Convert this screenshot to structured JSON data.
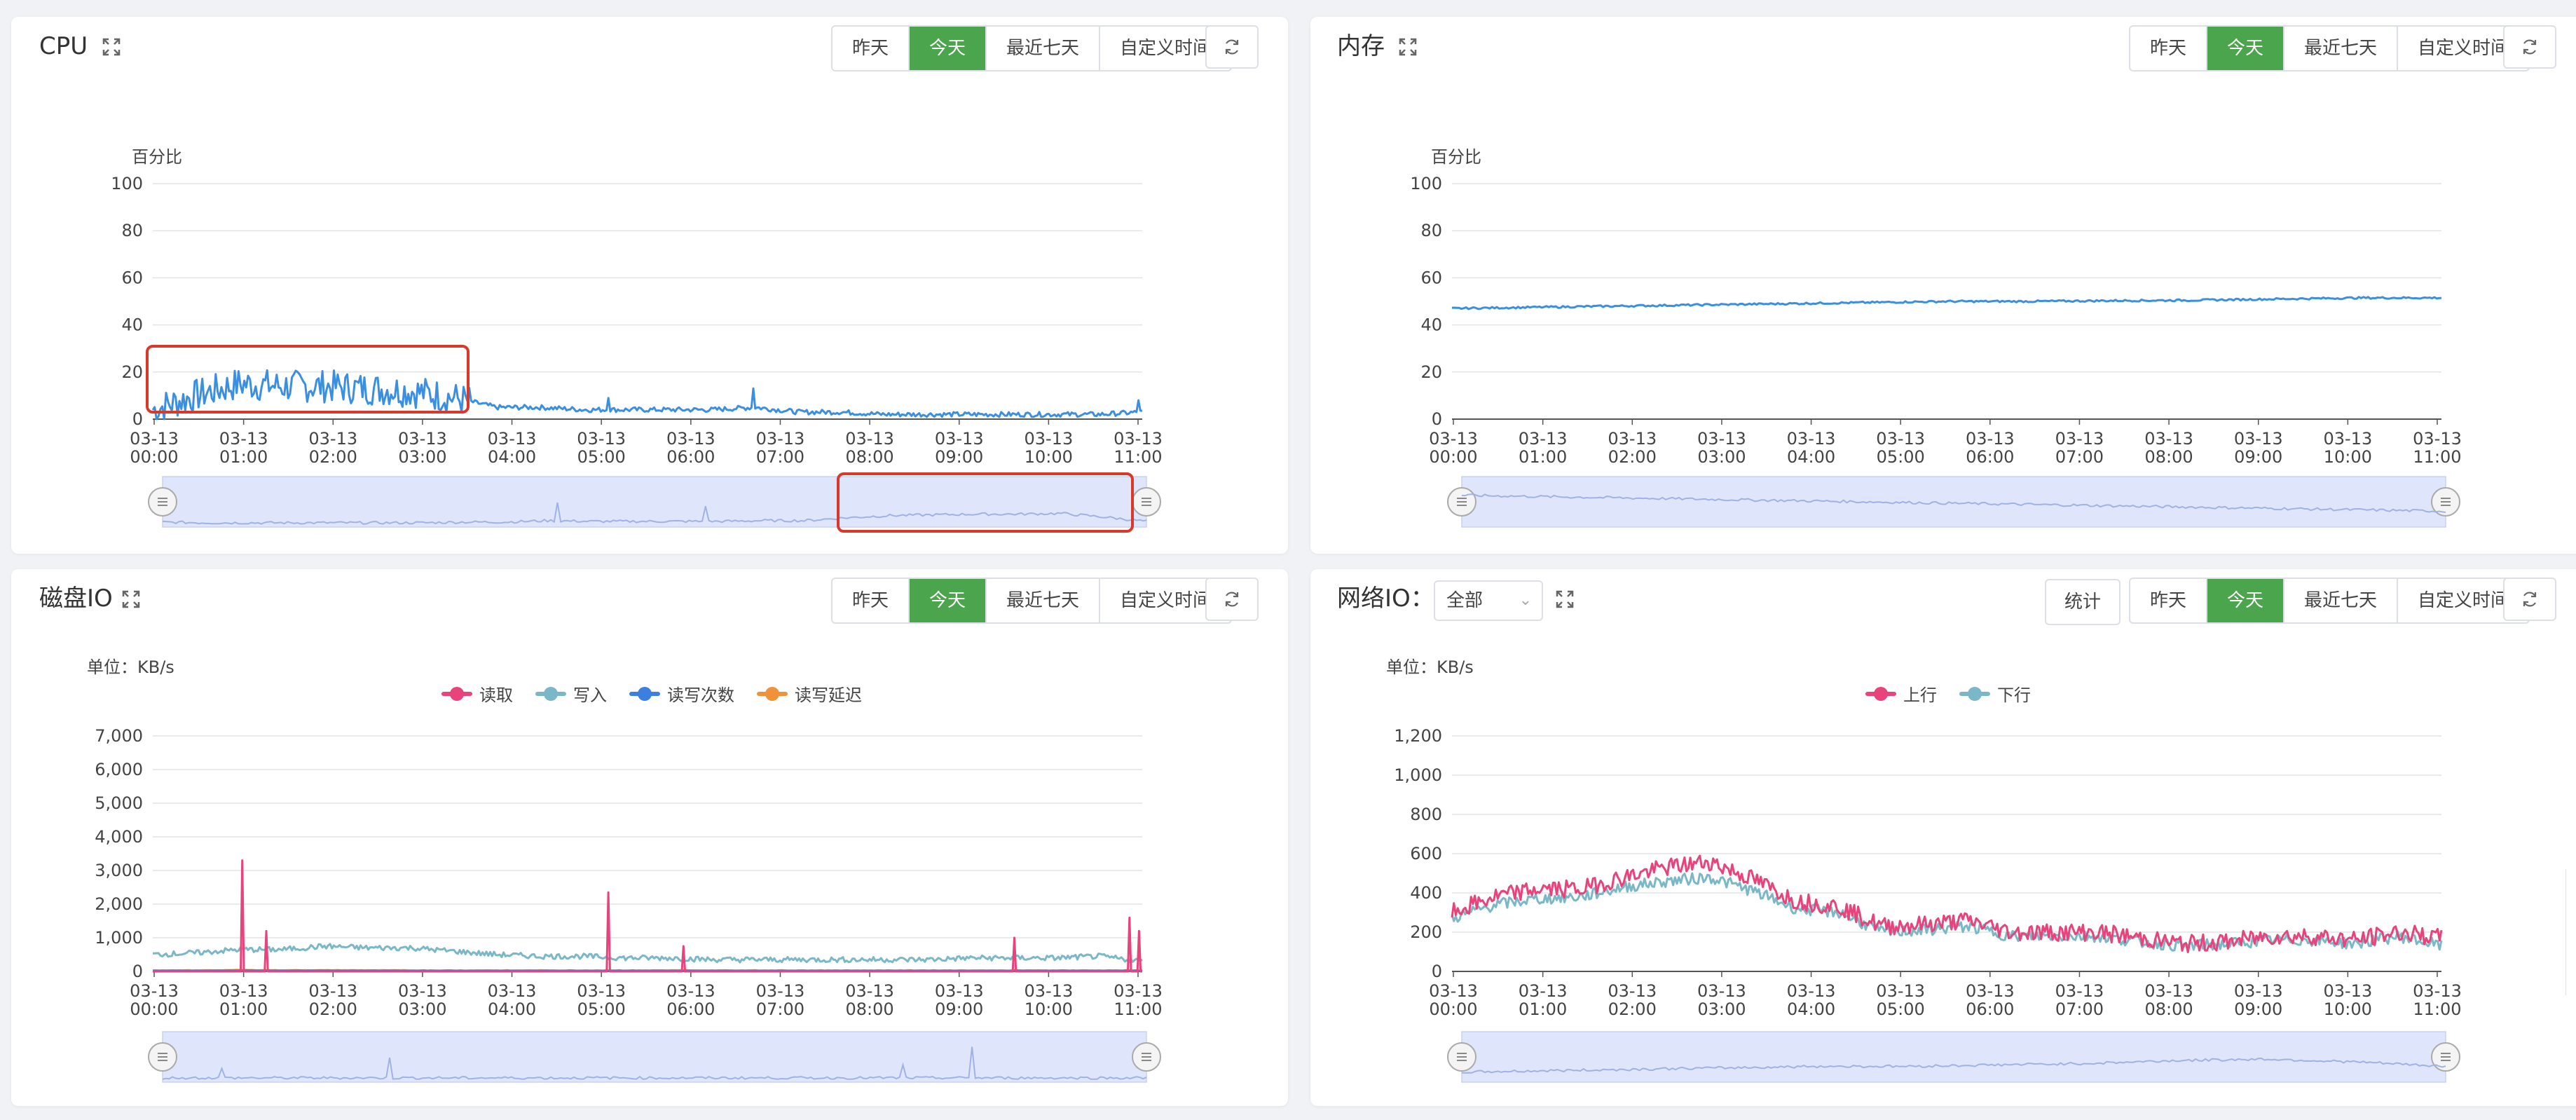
{
  "time_buttons": {
    "yesterday": "昨天",
    "today": "今天",
    "last7": "最近七天",
    "custom": "自定义时间"
  },
  "x_ticks": [
    [
      "03-13",
      "00:00"
    ],
    [
      "03-13",
      "01:00"
    ],
    [
      "03-13",
      "02:00"
    ],
    [
      "03-13",
      "03:00"
    ],
    [
      "03-13",
      "04:00"
    ],
    [
      "03-13",
      "05:00"
    ],
    [
      "03-13",
      "06:00"
    ],
    [
      "03-13",
      "07:00"
    ],
    [
      "03-13",
      "08:00"
    ],
    [
      "03-13",
      "09:00"
    ],
    [
      "03-13",
      "10:00"
    ],
    [
      "03-13",
      "11:00"
    ]
  ],
  "colors": {
    "accent": "#4aa54d",
    "cpu_line": "#3b8fe0",
    "mem_line": "#3b8fe0",
    "read": "#e8437a",
    "write": "#7ab8c8",
    "rw_count": "#3b7fe0",
    "rw_latency": "#f0923a",
    "up": "#e8437a",
    "down": "#7ab8c8",
    "highlight_box": "#d9392b",
    "dataZoom": "#dfe6fb"
  },
  "cpu": {
    "title": "CPU",
    "icons": {
      "expand": "expand-icon",
      "refresh": "refresh-icon"
    },
    "y_axis_name": "百分比",
    "y_ticks": [
      "100",
      "80",
      "60",
      "40",
      "20",
      "0"
    ]
  },
  "memory": {
    "title": "内存",
    "y_axis_name": "百分比",
    "y_ticks": [
      "100",
      "80",
      "60",
      "40",
      "20",
      "0"
    ]
  },
  "disk": {
    "title": "磁盘IO",
    "unit": "单位：KB/s",
    "legend": [
      "读取",
      "写入",
      "读写次数",
      "读写延迟"
    ],
    "y_ticks": [
      "7,000",
      "6,000",
      "5,000",
      "4,000",
      "3,000",
      "2,000",
      "1,000",
      "0"
    ]
  },
  "network": {
    "title": "网络IO：",
    "select_value": "全部",
    "stat_button": "统计",
    "unit": "单位：KB/s",
    "legend": [
      "上行",
      "下行"
    ],
    "y_ticks": [
      "1,200",
      "1,000",
      "800",
      "600",
      "400",
      "200",
      "0"
    ]
  },
  "chart_data": [
    {
      "type": "line",
      "title": "CPU",
      "ylabel": "百分比",
      "ylim": [
        0,
        100
      ],
      "x": [
        "00:00",
        "00:30",
        "01:00",
        "01:30",
        "02:00",
        "02:30",
        "03:00",
        "03:30",
        "04:00",
        "04:30",
        "05:00",
        "05:30",
        "06:00",
        "06:30",
        "07:00",
        "07:30",
        "08:00",
        "08:30",
        "09:00",
        "09:30",
        "10:00",
        "10:30",
        "11:00",
        "11:15"
      ],
      "series": [
        {
          "values": [
            4,
            10,
            15,
            14,
            14,
            13,
            12,
            9,
            5,
            5,
            4,
            4,
            4,
            4,
            5,
            3,
            3,
            2,
            2,
            2,
            2,
            2,
            2,
            3
          ]
        }
      ]
    },
    {
      "type": "line",
      "title": "内存",
      "ylabel": "百分比",
      "ylim": [
        0,
        100
      ],
      "x": [
        "00:00",
        "01:00",
        "02:00",
        "03:00",
        "04:00",
        "05:00",
        "06:00",
        "07:00",
        "08:00",
        "09:00",
        "10:00",
        "11:00",
        "11:15"
      ],
      "series": [
        {
          "values": [
            47,
            47.5,
            48,
            48.5,
            49,
            49.5,
            50,
            50,
            50.3,
            50.5,
            51,
            51.5,
            51.5
          ]
        }
      ]
    },
    {
      "type": "line",
      "title": "磁盘IO",
      "ylabel": "单位：KB/s",
      "ylim": [
        0,
        7000
      ],
      "x": [
        "00:00",
        "00:30",
        "01:00",
        "01:30",
        "02:00",
        "02:30",
        "03:00",
        "03:30",
        "04:00",
        "04:30",
        "05:00",
        "05:30",
        "06:00",
        "06:30",
        "07:00",
        "07:30",
        "08:00",
        "08:30",
        "09:00",
        "09:30",
        "10:00",
        "10:30",
        "11:00",
        "11:15"
      ],
      "series": [
        {
          "name": "读取",
          "values": [
            0,
            0,
            3300,
            0,
            0,
            0,
            0,
            0,
            0,
            0,
            2350,
            0,
            750,
            0,
            0,
            0,
            0,
            0,
            0,
            0,
            1000,
            0,
            1600,
            0
          ]
        },
        {
          "name": "写入",
          "values": [
            500,
            550,
            650,
            650,
            750,
            700,
            700,
            600,
            500,
            450,
            450,
            400,
            400,
            350,
            350,
            350,
            350,
            350,
            350,
            400,
            400,
            400,
            450,
            300
          ]
        },
        {
          "name": "读写次数",
          "values": [
            20,
            20,
            30,
            25,
            25,
            25,
            20,
            20,
            20,
            20,
            20,
            20,
            20,
            20,
            20,
            20,
            20,
            20,
            20,
            20,
            20,
            20,
            20,
            20
          ]
        },
        {
          "name": "读写延迟",
          "values": [
            30,
            30,
            40,
            35,
            35,
            35,
            30,
            30,
            30,
            30,
            30,
            30,
            30,
            30,
            30,
            30,
            30,
            30,
            30,
            30,
            30,
            30,
            30,
            30
          ]
        }
      ]
    },
    {
      "type": "line",
      "title": "网络IO",
      "ylabel": "单位：KB/s",
      "ylim": [
        0,
        1200
      ],
      "x": [
        "00:00",
        "00:30",
        "01:00",
        "01:30",
        "02:00",
        "02:30",
        "03:00",
        "03:30",
        "04:00",
        "04:30",
        "05:00",
        "05:30",
        "06:00",
        "06:30",
        "07:00",
        "07:30",
        "08:00",
        "08:30",
        "09:00",
        "09:30",
        "10:00",
        "10:30",
        "11:00",
        "11:15"
      ],
      "series": [
        {
          "name": "上行",
          "values": [
            300,
            380,
            420,
            420,
            480,
            530,
            560,
            470,
            360,
            330,
            230,
            240,
            260,
            200,
            200,
            200,
            170,
            140,
            150,
            180,
            180,
            160,
            200,
            170
          ]
        },
        {
          "name": "下行",
          "values": [
            270,
            340,
            370,
            380,
            430,
            460,
            480,
            410,
            320,
            300,
            200,
            210,
            230,
            180,
            180,
            180,
            150,
            130,
            140,
            160,
            160,
            140,
            180,
            130
          ]
        }
      ]
    }
  ]
}
